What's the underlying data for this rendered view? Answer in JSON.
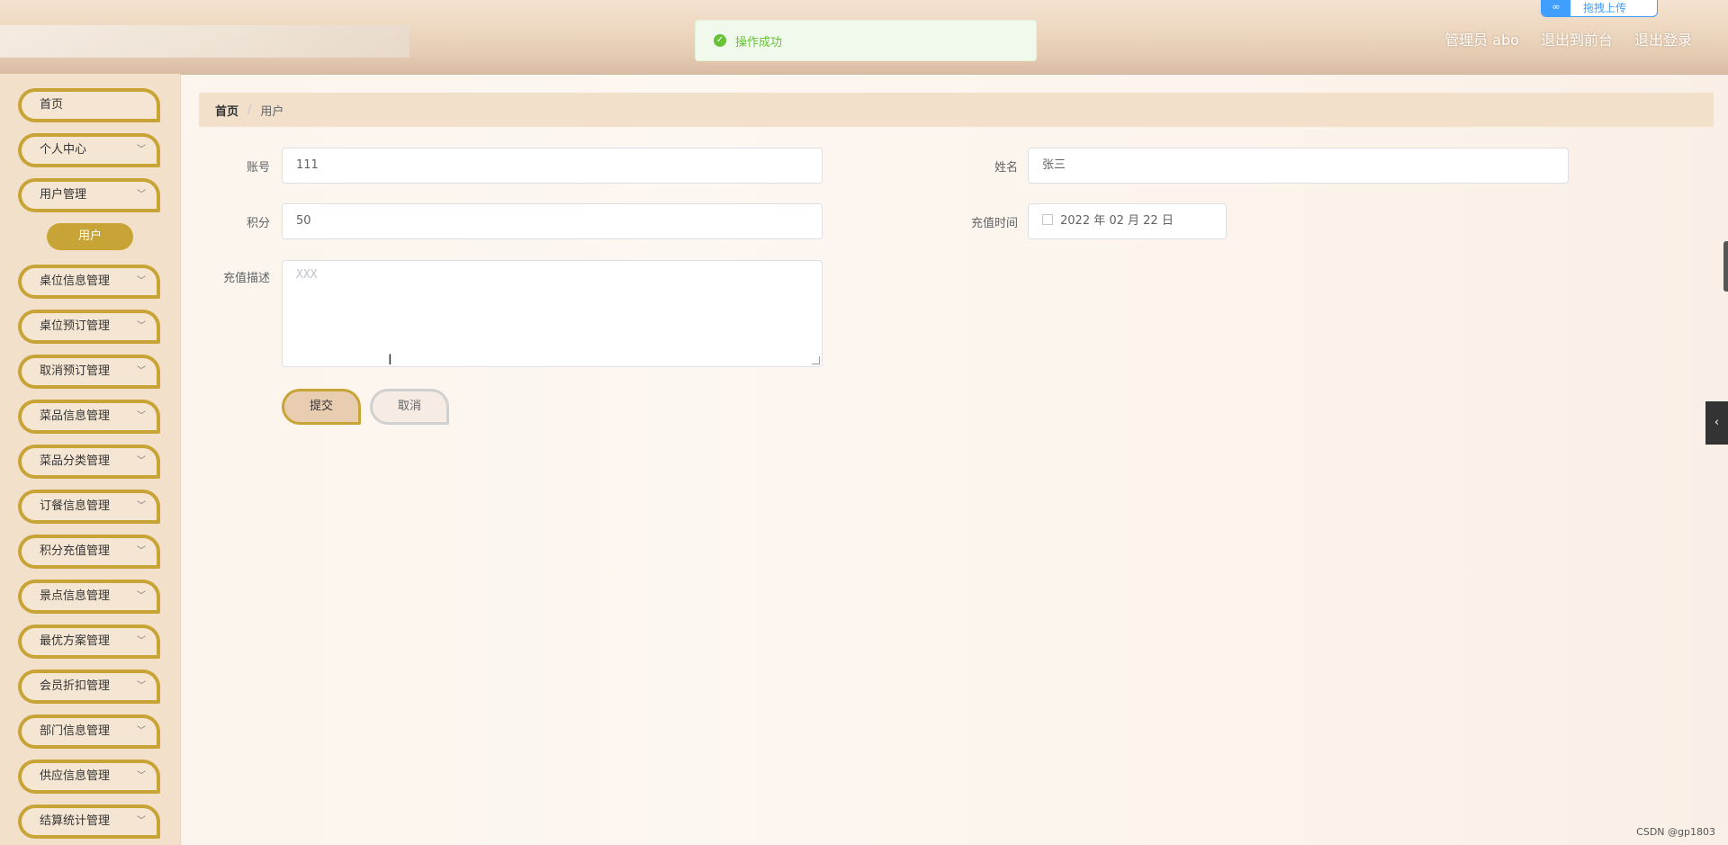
{
  "header": {
    "toast_message": "操作成功",
    "toast_icon": "check-circle-icon",
    "drag_upload_label": "拖拽上传",
    "nav": [
      "管理员 abo",
      "退出到前台",
      "退出登录"
    ]
  },
  "sidebar": {
    "items": [
      {
        "label": "首页",
        "expandable": false
      },
      {
        "label": "个人中心",
        "expandable": true
      },
      {
        "label": "用户管理",
        "expandable": true
      },
      {
        "label": "桌位信息管理",
        "expandable": true
      },
      {
        "label": "桌位预订管理",
        "expandable": true
      },
      {
        "label": "取消预订管理",
        "expandable": true
      },
      {
        "label": "菜品信息管理",
        "expandable": true
      },
      {
        "label": "菜品分类管理",
        "expandable": true
      },
      {
        "label": "订餐信息管理",
        "expandable": true
      },
      {
        "label": "积分充值管理",
        "expandable": true
      },
      {
        "label": "景点信息管理",
        "expandable": true
      },
      {
        "label": "最优方案管理",
        "expandable": true
      },
      {
        "label": "会员折扣管理",
        "expandable": true
      },
      {
        "label": "部门信息管理",
        "expandable": true
      },
      {
        "label": "供应信息管理",
        "expandable": true
      },
      {
        "label": "结算统计管理",
        "expandable": true
      }
    ],
    "active_sub_item": "用户"
  },
  "breadcrumb": {
    "home": "首页",
    "separator": "/",
    "current": "用户"
  },
  "form": {
    "account_label": "账号",
    "account_value": "111",
    "name_label": "姓名",
    "name_value": "张三",
    "points_label": "积分",
    "points_value": "50",
    "recharge_time_label": "充值时间",
    "recharge_time_value": "2022 年 02 月 22 日",
    "recharge_desc_label": "充值描述",
    "recharge_desc_value": "XXX"
  },
  "buttons": {
    "submit": "提交",
    "cancel": "取消"
  },
  "colors": {
    "accent": "#c8a436",
    "success": "#67c23a"
  },
  "watermark": "CSDN @gp1803"
}
